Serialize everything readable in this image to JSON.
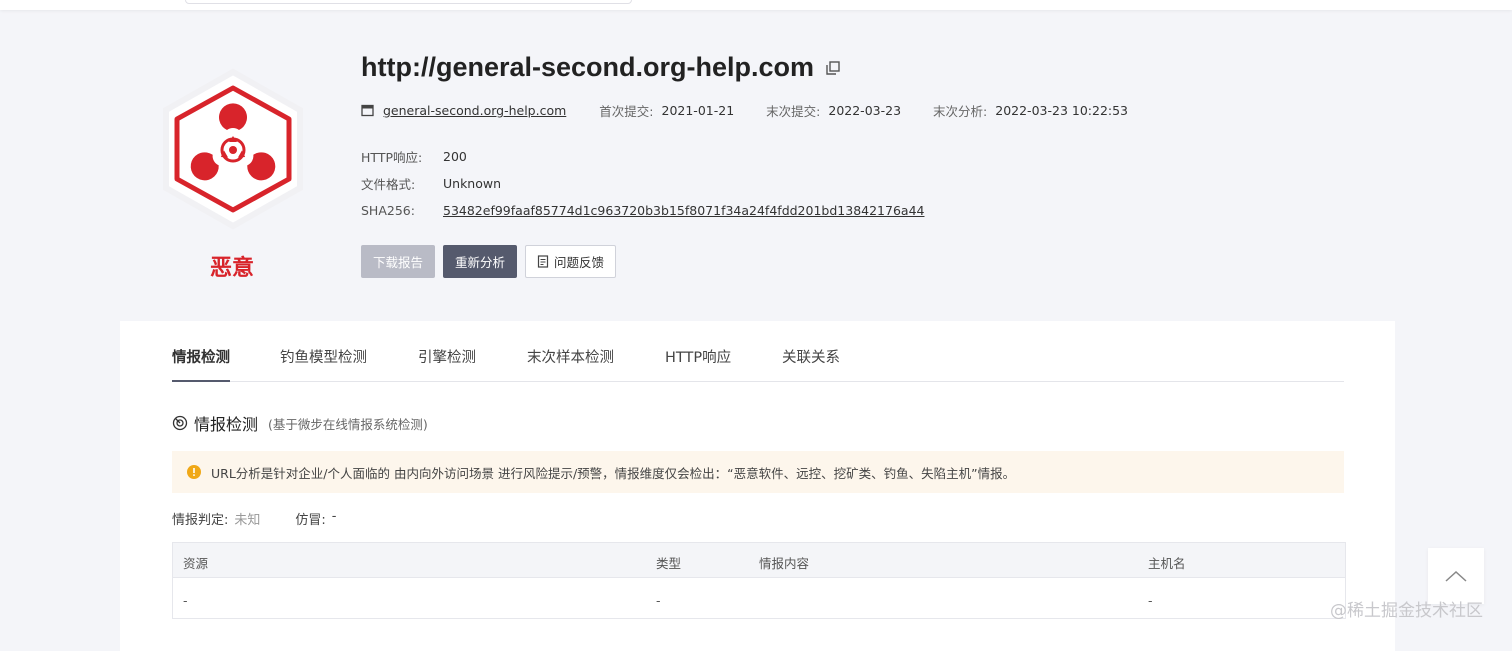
{
  "header": {
    "url": "http://general-second.org-help.com",
    "domain": "general-second.org-help.com",
    "first_submit_label": "首次提交:",
    "first_submit": "2021-01-21",
    "last_submit_label": "末次提交:",
    "last_submit": "2022-03-23",
    "last_analysis_label": "末次分析:",
    "last_analysis": "2022-03-23 10:22:53"
  },
  "verdict": {
    "label": "恶意",
    "color": "#d8242b"
  },
  "details": [
    {
      "label": "HTTP响应:",
      "value": "200"
    },
    {
      "label": "文件格式:",
      "value": "Unknown"
    },
    {
      "label": "SHA256:",
      "value": "53482ef99faaf85774d1c963720b3b15f8071f34a24f4fdd201bd13842176a44"
    }
  ],
  "actions": {
    "download": "下载报告",
    "reanalyze": "重新分析",
    "feedback": "问题反馈"
  },
  "tabs": [
    "情报检测",
    "钓鱼模型检测",
    "引擎检测",
    "末次样本检测",
    "HTTP响应",
    "关联关系"
  ],
  "section": {
    "title": "情报检测",
    "subtitle": "(基于微步在线情报系统检测)"
  },
  "notice": "URL分析是针对企业/个人面临的 由内向外访问场景 进行风险提示/预警，情报维度仅会检出：“恶意软件、远控、挖矿类、钓鱼、失陷主机”情报。",
  "intel_verdict": {
    "label": "情报判定:",
    "value": "未知",
    "impersonation_label": "仿冒:",
    "impersonation_value": "-"
  },
  "table": {
    "columns": [
      "资源",
      "类型",
      "情报内容",
      "主机名"
    ],
    "rows": [
      [
        "-",
        "-",
        "",
        "-"
      ]
    ]
  },
  "watermark": "@稀土掘金技术社区",
  "colors": {
    "accent": "#555a6d",
    "malicious": "#d8242b",
    "notice_bg": "#fdf6ec",
    "notice_icon": "#f0a817"
  }
}
